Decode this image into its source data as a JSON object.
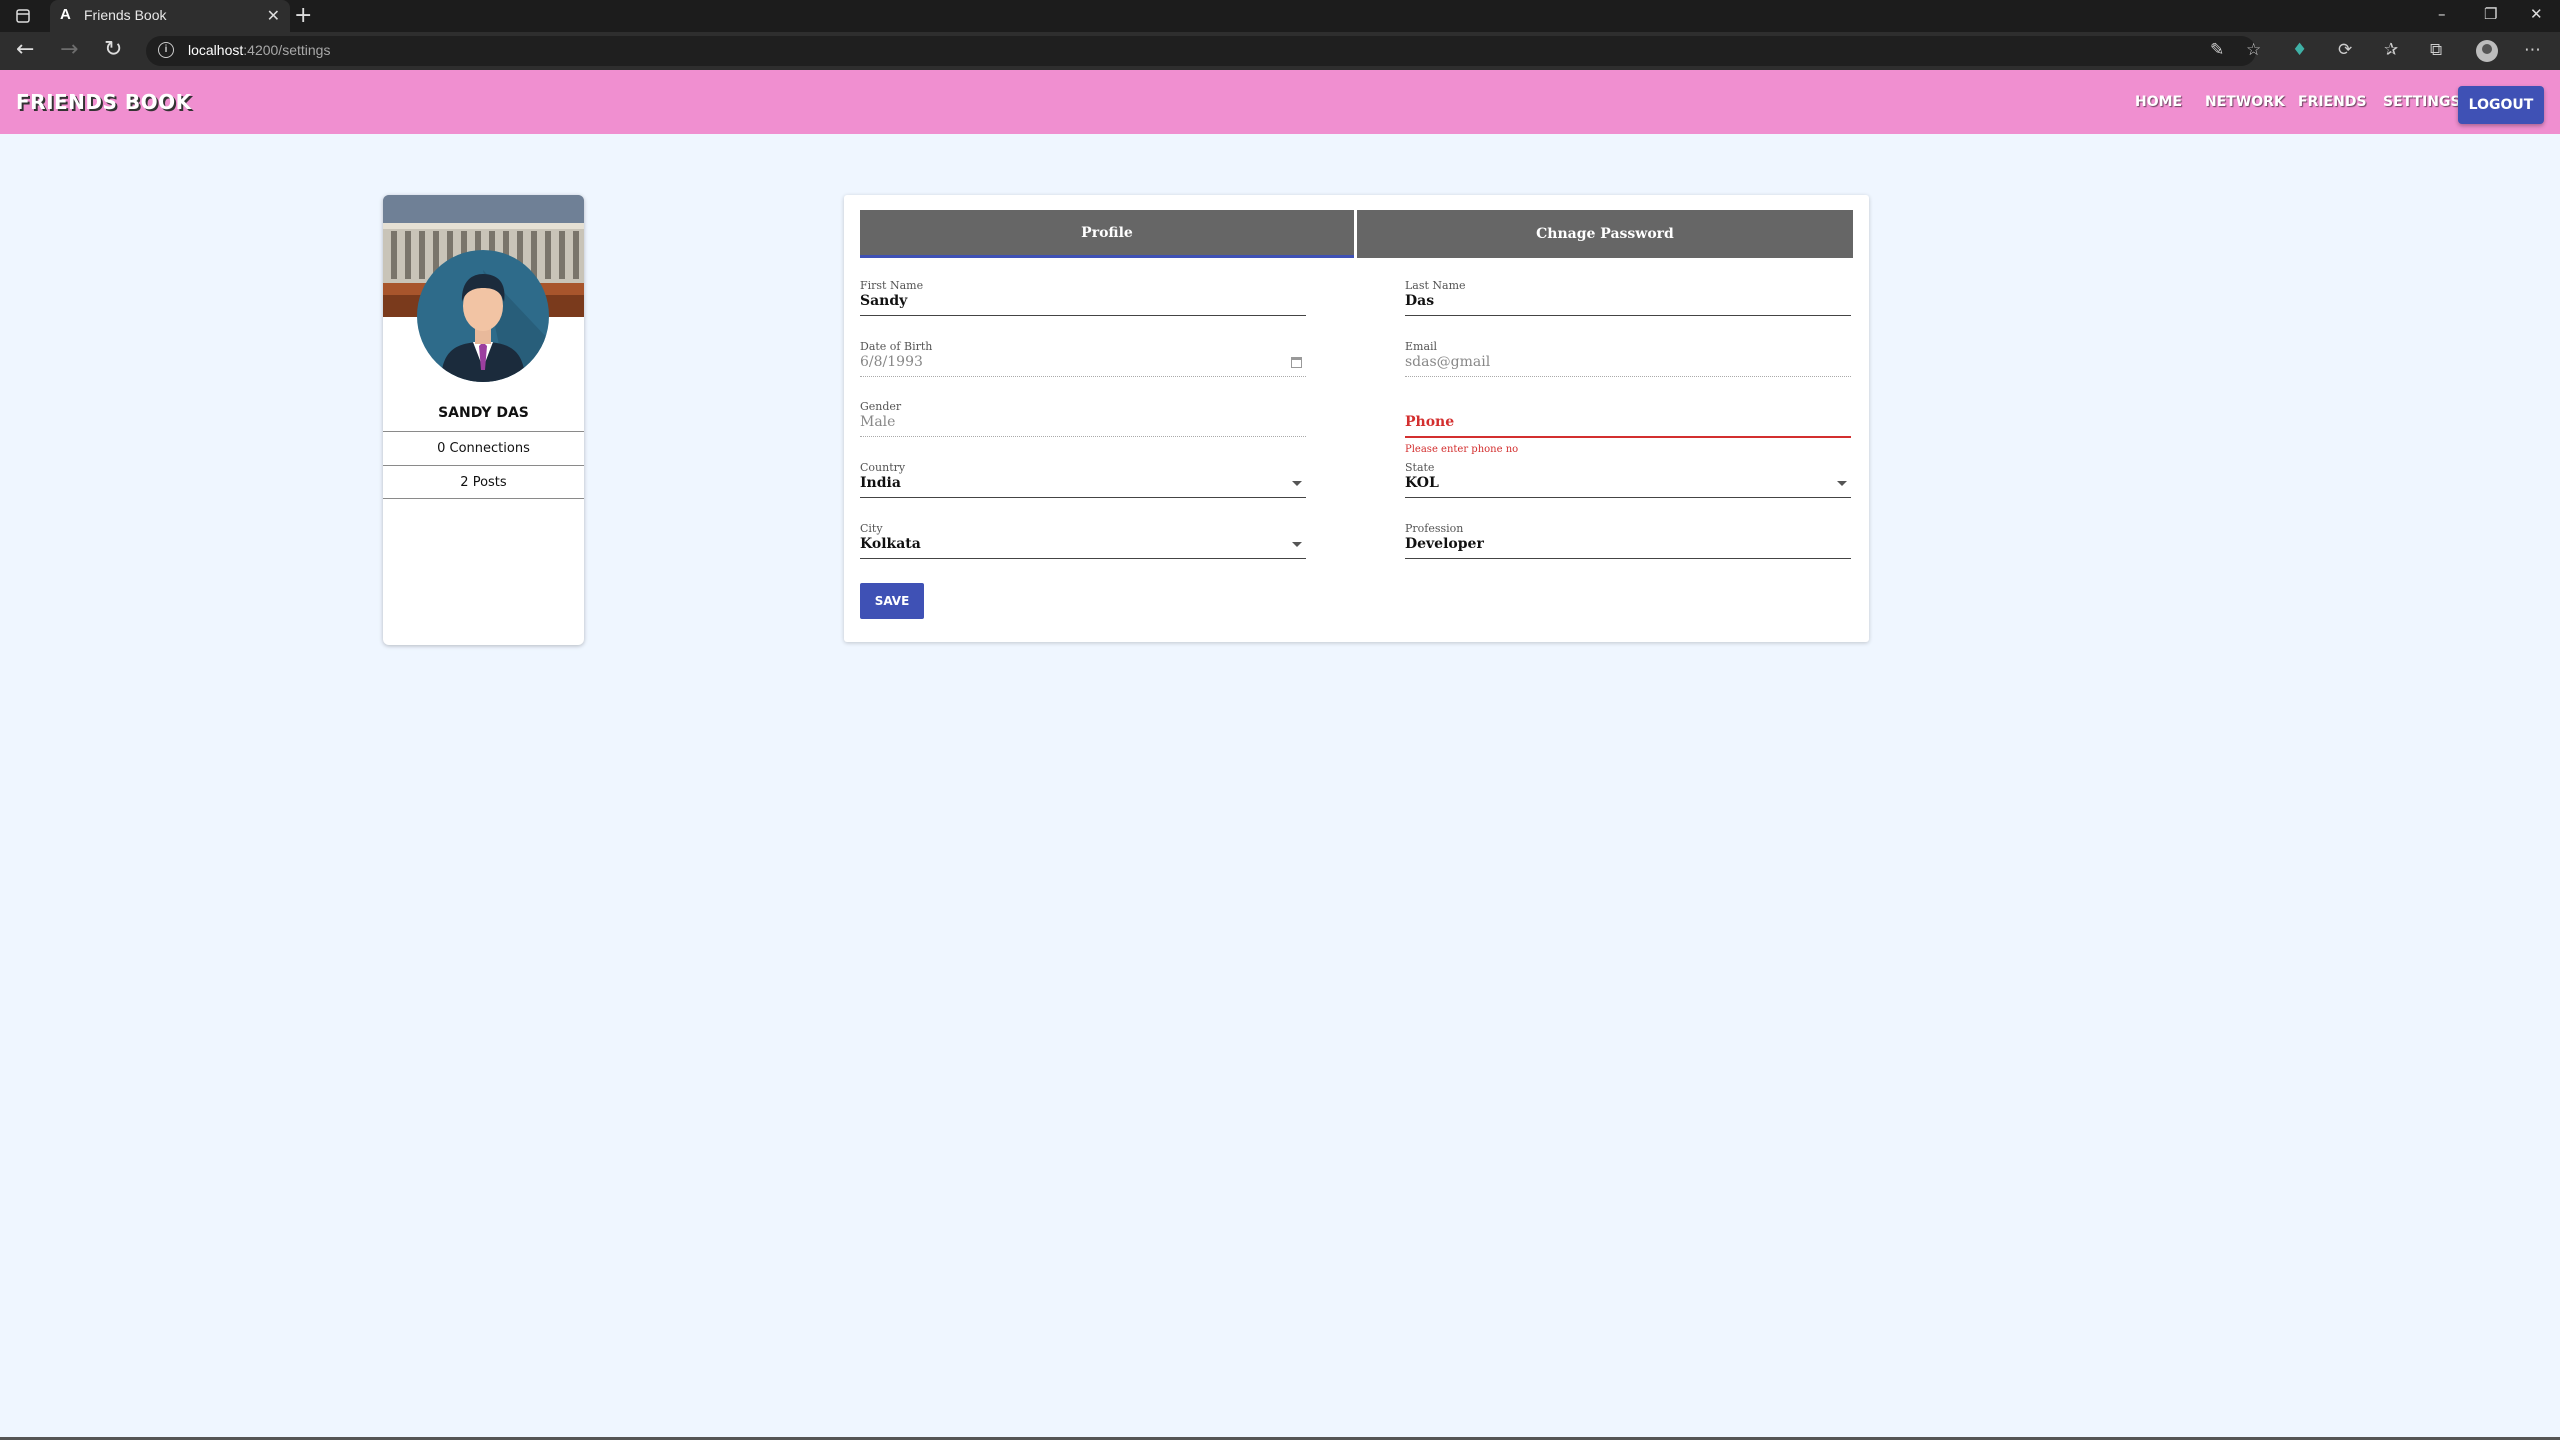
{
  "browser": {
    "tab_title": "Friends Book",
    "tab_favicon": "A",
    "url_host": "localhost",
    "url_path": ":4200/settings",
    "icons": [
      "tab-actions-icon",
      "close-icon",
      "new-tab-icon",
      "back-icon",
      "forward-icon",
      "refresh-icon",
      "site-info-icon",
      "read-aloud-icon",
      "add-favorite-icon",
      "extension-icon",
      "sync-icon",
      "favorites-icon",
      "collections-icon",
      "profile-icon",
      "more-icon",
      "minimize-icon",
      "restore-icon",
      "window-close-icon"
    ]
  },
  "header": {
    "brand": "FRIENDS BOOK",
    "nav": [
      "HOME",
      "NETWORK",
      "FRIENDS",
      "SETTINGS"
    ],
    "logout": "LOGOUT",
    "background": "#f08fd0",
    "accent": "#3f51b5"
  },
  "profile_card": {
    "name": "SANDY DAS",
    "connections": "0 Connections",
    "posts": "2 Posts"
  },
  "settings": {
    "tabs": [
      "Profile",
      "Chnage Password"
    ],
    "active_tab": "Profile",
    "first_name": {
      "label": "First Name",
      "value": "Sandy"
    },
    "last_name": {
      "label": "Last Name",
      "value": "Das"
    },
    "dob": {
      "label": "Date of Birth",
      "value": "6/8/1993"
    },
    "email": {
      "label": "Email",
      "value": "sdas@gmail"
    },
    "gender": {
      "label": "Gender",
      "value": "Male"
    },
    "phone": {
      "placeholder": "Phone",
      "error": "Please enter phone no"
    },
    "country": {
      "label": "Country",
      "value": "India"
    },
    "state": {
      "label": "State",
      "value": "KOL"
    },
    "city": {
      "label": "City",
      "value": "Kolkata"
    },
    "profession": {
      "label": "Profession",
      "value": "Developer"
    },
    "save": "SAVE",
    "error_color": "#d32f2f"
  }
}
